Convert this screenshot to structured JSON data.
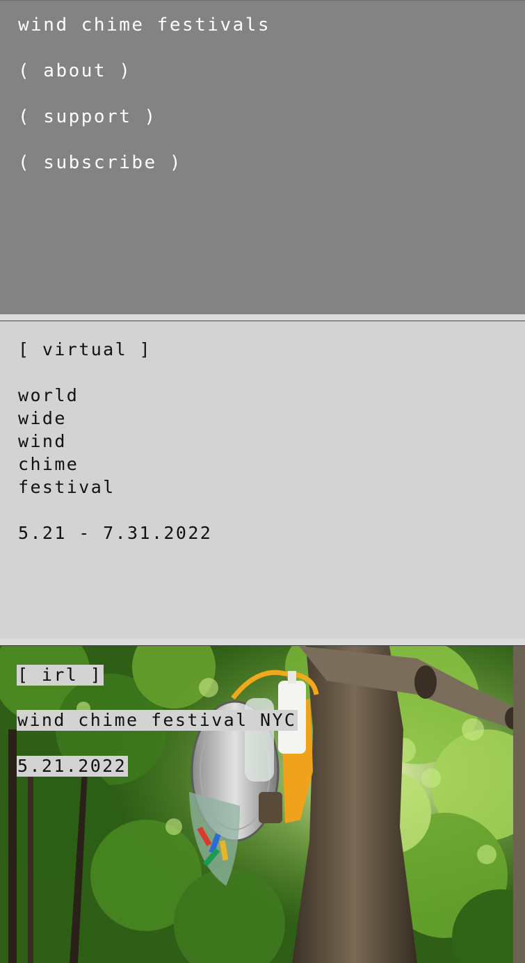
{
  "nav": {
    "title": "wind chime festivals",
    "links": [
      {
        "label": "( about )"
      },
      {
        "label": "( support )"
      },
      {
        "label": "( subscribe )"
      }
    ]
  },
  "virtual": {
    "tag": "[ virtual ]",
    "name_lines": [
      "world",
      "wide",
      "wind",
      "chime",
      "festival"
    ],
    "dates": "5.21 - 7.31.2022"
  },
  "irl": {
    "tag": "[ irl ]",
    "event_name": "wind chime festival NYC",
    "date": "5.21.2022"
  },
  "colors": {
    "nav_bg": "#838383",
    "panel_bg": "#d3d3d3",
    "foliage": "#3f7a1e"
  }
}
